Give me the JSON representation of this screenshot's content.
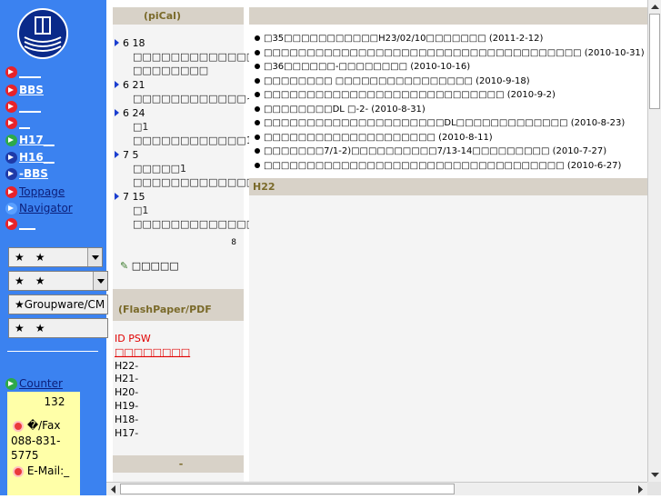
{
  "sidebar": {
    "nav": [
      {
        "label": "____",
        "color": "red"
      },
      {
        "label": "BBS",
        "color": "red"
      },
      {
        "label": "____",
        "color": "red"
      },
      {
        "label": "__",
        "color": "red"
      },
      {
        "label": "H17__",
        "color": "green"
      },
      {
        "label": "H16__",
        "color": "navy"
      },
      {
        "label": "-BBS",
        "color": "navy"
      },
      {
        "label": "Toppage",
        "color": "red"
      },
      {
        "label": "Navigator",
        "color": "lblue"
      },
      {
        "label": "___",
        "color": "red"
      }
    ],
    "selects": [
      {
        "label": "★　★"
      },
      {
        "label": "★　★"
      },
      {
        "label": "★Groupware/CM"
      },
      {
        "label": "★　★"
      }
    ],
    "counter_link": "Counter",
    "counter_value": "132",
    "fax_label": "�/Fax",
    "phone": "088-831-5775",
    "email_label": "E-Mail:_"
  },
  "calendar": {
    "header": "(piCal)",
    "events": [
      {
        "date": "6 18",
        "text": "□□□□□□□□□□□□□1 □□□□□□□□"
      },
      {
        "date": "6 21",
        "text": "□□□□□□□□□□□□~"
      },
      {
        "date": "6 24",
        "text": "□1 □□□□□□□□□□□□14:00□"
      },
      {
        "date": "7 5",
        "text": "□□□□□1 □□□□□□□□□□□□□6□□□"
      },
      {
        "date": "7 15",
        "text": "□1 □□□□□□□□□□□□□14:00□"
      }
    ],
    "count": "8",
    "more_label": "□□□□□"
  },
  "flashpaper": {
    "header": "(FlashPaper/PDF",
    "id_psw": "ID  PSW",
    "red_link": "□□□□□□□□",
    "years": [
      "H22-",
      "H21-",
      "H20-",
      "H19-",
      "H18-",
      "H17-"
    ],
    "footer_header": "-",
    "bottom_red": "□□□□□□□□"
  },
  "news": {
    "items": [
      {
        "text": "□35□□□□□□□□□□□H23/02/10□□□□□□□",
        "date": "(2011-2-12)"
      },
      {
        "text": "□□□□□□□□□□□□□□□□□□□□□□□□□□□□□□□□□□□□□",
        "date": "(2010-10-31)"
      },
      {
        "text": "□36□□□□□□-□□□□□□□□",
        "date": "(2010-10-16)"
      },
      {
        "text": "□□□□□□□□ □□□□□□□□□□□□□□□□",
        "date": "(2010-9-18)"
      },
      {
        "text": "□□□□□□□□□□□□□□□□□□□□□□□□□□□□",
        "date": "(2010-9-2)"
      },
      {
        "text": "□□□□□□□□DL □-2-",
        "date": "(2010-8-31)"
      },
      {
        "text": "□□□□□□□□□□□□□□□□□□□□□DL□□□□□□□□□□□□□",
        "date": "(2010-8-23)"
      },
      {
        "text": "□□□□□□□□□□□□□□□□□□□□",
        "date": "(2010-8-11)"
      },
      {
        "text": "□□□□□□□7/1-2)□□□□□□□□□□7/13-14□□□□□□□□□",
        "date": "(2010-7-27)"
      },
      {
        "text": "□□□□□□□□□□□□□□□□□□□□□□□□□□□□□□□□□□□",
        "date": "(2010-6-27)"
      }
    ],
    "section_header": "H22"
  }
}
